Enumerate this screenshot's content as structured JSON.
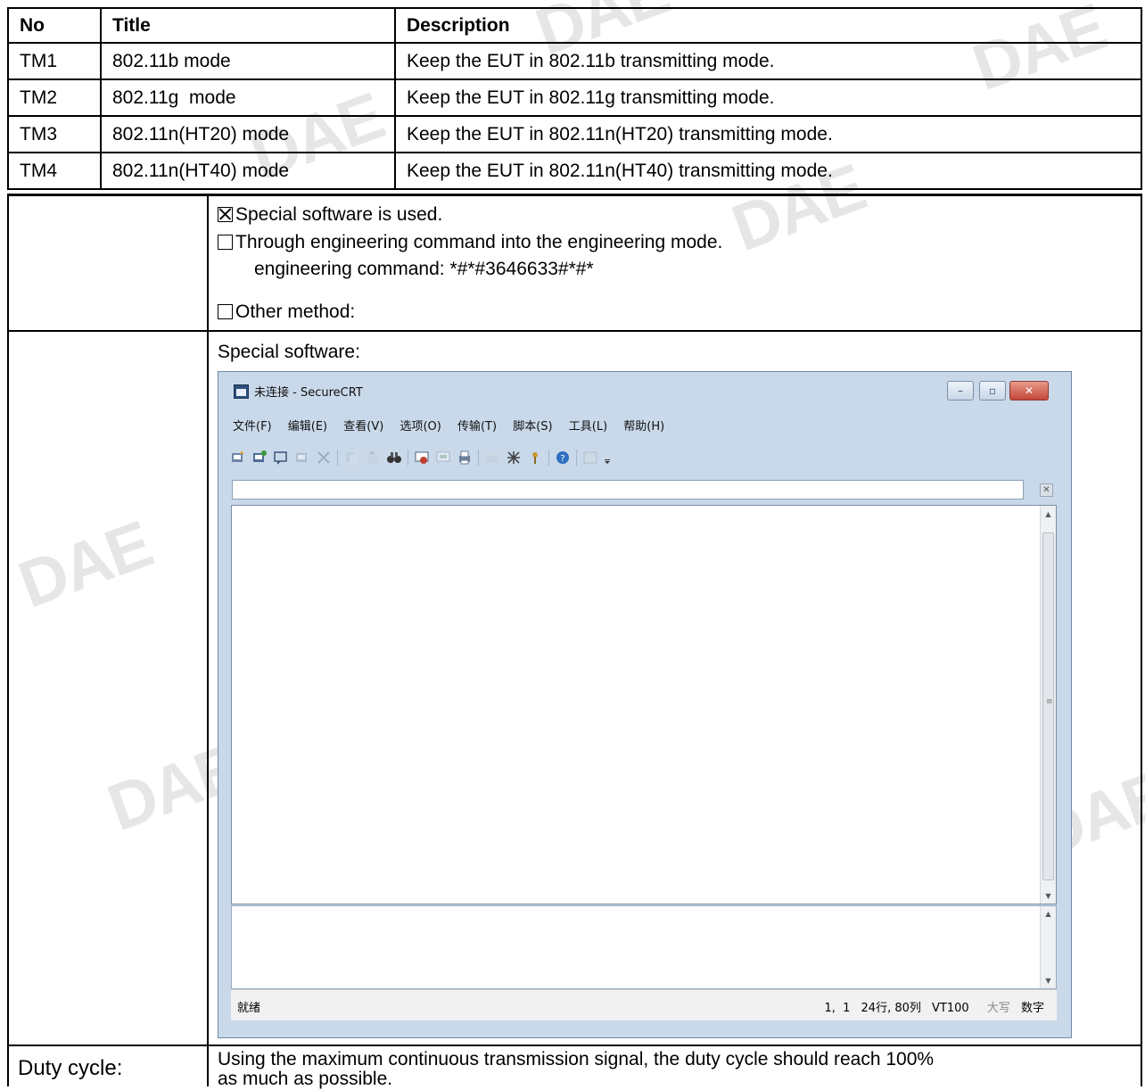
{
  "watermark": "DAE",
  "mode_table": {
    "headers": [
      "No",
      "Title",
      "Description"
    ],
    "rows": [
      [
        "TM1",
        "802.11b mode",
        "Keep the EUT in 802.11b transmitting mode."
      ],
      [
        "TM2",
        "802.11g  mode",
        "Keep the EUT in 802.11g transmitting mode."
      ],
      [
        "TM3",
        "802.11n(HT20) mode",
        "Keep the EUT in 802.11n(HT20) transmitting mode."
      ],
      [
        "TM4",
        "802.11n(HT40) mode",
        "Keep the EUT in 802.11n(HT40) transmitting mode."
      ]
    ]
  },
  "method": {
    "opt_special": "Special software is used.",
    "opt_special_checked": true,
    "opt_engineering": "Through engineering command into the engineering mode.",
    "opt_engineering_checked": false,
    "engineering_command": "engineering command: *#*#3646633#*#*",
    "opt_other": "Other method:",
    "opt_other_checked": false
  },
  "software_label": "Special software:",
  "securecrt": {
    "title": "未连接 - SecureCRT",
    "window_buttons": [
      "–",
      "▫",
      "✕"
    ],
    "menus": [
      "文件(F)",
      "编辑(E)",
      "查看(V)",
      "选项(O)",
      "传输(T)",
      "脚本(S)",
      "工具(L)",
      "帮助(H)"
    ],
    "status": {
      "ready": "就绪",
      "cursor": "1,  1",
      "size": "24行, 80列",
      "terminal": "VT100",
      "caps": "大写",
      "num": "数字"
    }
  },
  "duty_cycle": {
    "label": "Duty cycle:",
    "text_line1": "Using the maximum continuous transmission signal, the duty cycle should reach 100%",
    "text_line2": "as much as possible."
  }
}
